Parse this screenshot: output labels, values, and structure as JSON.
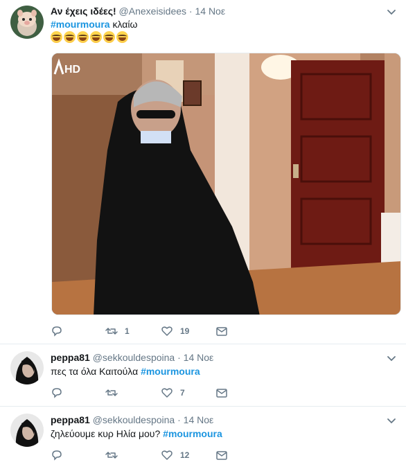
{
  "tweets": [
    {
      "name": "Αν έχεις ιδέες!",
      "handle": "@Anexeisidees",
      "dot": "·",
      "time": "14 Νοε",
      "hashtag": "#mourmoura",
      "text_after": " κλαίω",
      "emoji_count": 6,
      "emoji": "😂",
      "media_logo": "HD",
      "counts": {
        "reply": "",
        "retweet": "1",
        "like": "19"
      }
    },
    {
      "name": "peppa81",
      "handle": "@sekkouldespoina",
      "dot": "·",
      "time": "14 Νοε",
      "text_before": "πες τα όλα Καιτούλα ",
      "hashtag": "#mourmoura",
      "counts": {
        "reply": "",
        "retweet": "",
        "like": "7"
      }
    },
    {
      "name": "peppa81",
      "handle": "@sekkouldespoina",
      "dot": "·",
      "time": "14 Νοε",
      "text_before": "ζηλεύουμε κυρ Ηλία μου? ",
      "hashtag": "#mourmoura",
      "counts": {
        "reply": "",
        "retweet": "",
        "like": "12"
      }
    }
  ],
  "colors": {
    "link": "#1b95e0",
    "muted": "#657786",
    "text": "#14171a",
    "border": "#e6ecf0"
  },
  "icons": [
    "reply-icon",
    "retweet-icon",
    "like-icon",
    "message-icon",
    "caret-down-icon"
  ]
}
